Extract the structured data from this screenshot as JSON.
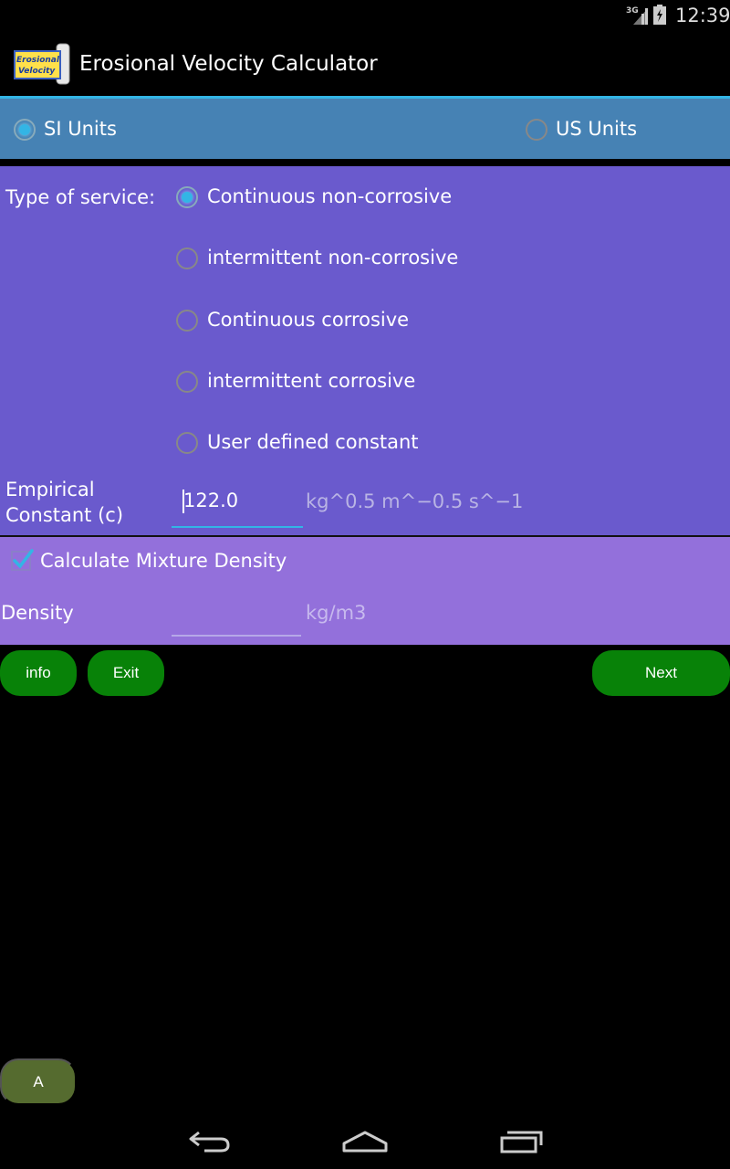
{
  "status_bar": {
    "network": "3G",
    "time": "12:39"
  },
  "app": {
    "title": "Erosional Velocity Calculator",
    "icon_text_line1": "Erosional",
    "icon_text_line2": "Velocity"
  },
  "units": {
    "options": [
      {
        "label": "SI Units",
        "checked": true
      },
      {
        "label": "US Units",
        "checked": false
      }
    ]
  },
  "service": {
    "label": "Type of service:",
    "options": [
      {
        "label": "Continuous non-corrosive",
        "checked": true
      },
      {
        "label": "intermittent non-corrosive",
        "checked": false
      },
      {
        "label": "Continuous corrosive",
        "checked": false
      },
      {
        "label": "intermittent corrosive",
        "checked": false
      },
      {
        "label": "User defined constant",
        "checked": false
      }
    ]
  },
  "constant": {
    "label_line1": "Empirical",
    "label_line2": "Constant (c)",
    "value": "122.0",
    "unit": "kg^0.5 m^−0.5 s^−1"
  },
  "mixture": {
    "checkbox_label": "Calculate Mixture Density",
    "checked": true,
    "density_label": "Density",
    "density_value": "",
    "density_unit": "kg/m3"
  },
  "buttons": {
    "info": "info",
    "exit": "Exit",
    "next": "Next",
    "a": "A"
  },
  "colors": {
    "accent": "#33b5e5",
    "units_bar": "#4682b4",
    "service_panel": "#6a5acd",
    "mixture_panel": "#9370db",
    "button_green": "#088208",
    "button_olive": "#556b2f"
  }
}
